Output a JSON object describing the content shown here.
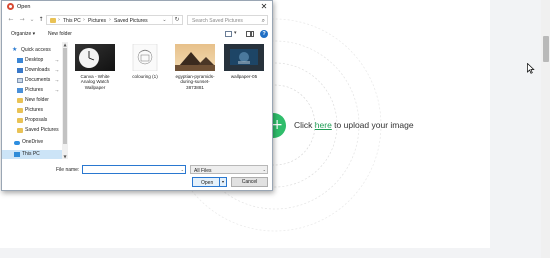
{
  "webpage": {
    "upload_prefix": "Click ",
    "upload_link": "here",
    "upload_suffix": " to upload your image",
    "plus_symbol": "+"
  },
  "dialog": {
    "title": "Open",
    "close_symbol": "✕",
    "nav": {
      "back": "←",
      "forward": "→",
      "recent": "⌄",
      "up": "↑"
    },
    "breadcrumb": [
      "This PC",
      "Pictures",
      "Saved Pictures"
    ],
    "breadcrumb_sep": "›",
    "address_dropdown": "⌄",
    "refresh_symbol": "↻",
    "search_placeholder": "Search Saved Pictures",
    "search_symbol": "⌕",
    "toolbar": {
      "organize": "Organize ▾",
      "new_folder": "New folder",
      "view_drop": "▾",
      "help": "?"
    },
    "nav_pane": [
      {
        "label": "Quick access",
        "icon": "star-icon",
        "pinned": false,
        "selected": false
      },
      {
        "label": "Desktop",
        "icon": "desktop-icon",
        "pinned": true,
        "selected": false
      },
      {
        "label": "Downloads",
        "icon": "download-icon",
        "pinned": true,
        "selected": false
      },
      {
        "label": "Documents",
        "icon": "documents-icon",
        "pinned": true,
        "selected": false
      },
      {
        "label": "Pictures",
        "icon": "pictures-icon",
        "pinned": true,
        "selected": false
      },
      {
        "label": "New folder",
        "icon": "folder-icon",
        "pinned": false,
        "selected": false
      },
      {
        "label": "Pictures",
        "icon": "folder-icon",
        "pinned": false,
        "selected": false
      },
      {
        "label": "Proposals",
        "icon": "folder-icon",
        "pinned": false,
        "selected": false
      },
      {
        "label": "Saved Pictures",
        "icon": "folder-icon",
        "pinned": false,
        "selected": false
      },
      {
        "label": "OneDrive",
        "icon": "cloud-icon",
        "pinned": false,
        "selected": false
      },
      {
        "label": "This PC",
        "icon": "computer-icon",
        "pinned": false,
        "selected": true
      }
    ],
    "pin_symbol": "📌",
    "scroll_up": "▲",
    "scroll_down": "▼",
    "files": [
      {
        "name": "Canva - White Analog Watch Wallpaper",
        "thumb": "watch-wallpaper-thumbnail"
      },
      {
        "name": "colouring (1)",
        "thumb": "colouring-thumbnail"
      },
      {
        "name": "egyptian-pyramids-during-sunset-3873881",
        "thumb": "pyramids-thumbnail"
      },
      {
        "name": "wallpaper-05",
        "thumb": "wallpaper-thumbnail"
      }
    ],
    "footer": {
      "filename_label": "File name:",
      "filename_value": "",
      "dropdown_symbol": "⌄",
      "filter_value": "All Files",
      "open_label": "Open",
      "open_split": "▾",
      "cancel_label": "Cancel"
    }
  }
}
